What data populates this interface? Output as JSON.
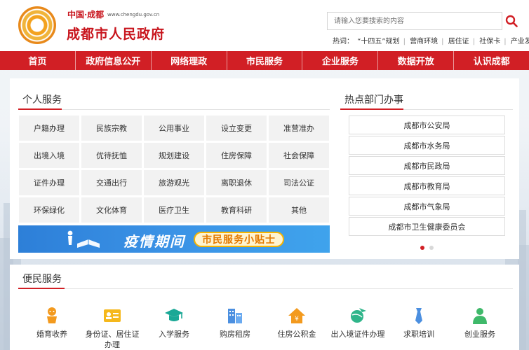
{
  "header": {
    "site_cn": "中国·成都",
    "site_url": "www.chengdu.gov.cn",
    "site_title": "成都市人民政府",
    "search_placeholder": "请输入您要搜索的内容",
    "hot_label": "热词：",
    "hot_words": [
      "“十四五”规划",
      "营商环境",
      "居住证",
      "社保卡",
      "产业发展"
    ]
  },
  "nav": {
    "items": [
      "首页",
      "政府信息公开",
      "网络理政",
      "市民服务",
      "企业服务",
      "数据开放",
      "认识成都"
    ]
  },
  "personal": {
    "title": "个人服务",
    "items": [
      "户籍办理",
      "民族宗教",
      "公用事业",
      "设立变更",
      "准营准办",
      "出境入境",
      "优待抚恤",
      "规划建设",
      "住房保障",
      "社会保障",
      "证件办理",
      "交通出行",
      "旅游观光",
      "离职退休",
      "司法公证",
      "环保绿化",
      "文化体育",
      "医疗卫生",
      "教育科研",
      "其他"
    ]
  },
  "banner": {
    "main": "疫情期间",
    "pill": "市民服务小贴士"
  },
  "hot_dept": {
    "title": "热点部门办事",
    "items": [
      "成都市公安局",
      "成都市水务局",
      "成都市民政局",
      "成都市教育局",
      "成都市气象局",
      "成都市卫生健康委员会"
    ]
  },
  "convenience": {
    "title": "便民服务",
    "items": [
      {
        "label": "婚育收养",
        "icon": "baby-icon"
      },
      {
        "label": "身份证、居住证办理",
        "icon": "id-card-icon"
      },
      {
        "label": "入学服务",
        "icon": "graduation-cap-icon"
      },
      {
        "label": "购房租房",
        "icon": "building-icon"
      },
      {
        "label": "住房公积金",
        "icon": "house-yuan-icon"
      },
      {
        "label": "出入境证件办理",
        "icon": "globe-plane-icon"
      },
      {
        "label": "求职培训",
        "icon": "tie-icon"
      },
      {
        "label": "创业服务",
        "icon": "person-icon"
      }
    ]
  },
  "colors": {
    "brand_red": "#d11f25",
    "banner_blue": "#3b93e6"
  }
}
